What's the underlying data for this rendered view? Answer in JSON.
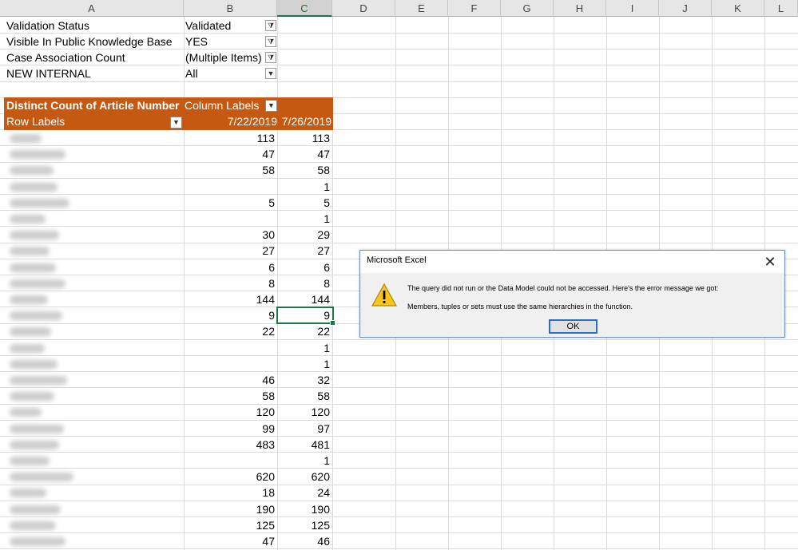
{
  "columns": [
    "A",
    "B",
    "C",
    "D",
    "E",
    "F",
    "G",
    "H",
    "I",
    "J",
    "K",
    "L"
  ],
  "filters": [
    {
      "label": "Validation Status",
      "value": "Validated",
      "icon": "filter-applied-icon"
    },
    {
      "label": "Visible In Public Knowledge Base",
      "value": "YES",
      "icon": "filter-applied-icon"
    },
    {
      "label": "Case Association Count",
      "value": "(Multiple Items)",
      "icon": "filter-applied-icon"
    },
    {
      "label": "NEW INTERNAL",
      "value": "All",
      "icon": "dropdown-arrow-icon"
    }
  ],
  "pivot": {
    "measure_header": "Distinct Count of Article Number",
    "column_labels": "Column Labels",
    "row_labels": "Row Labels",
    "col_dates": [
      "7/22/2019",
      "7/26/2019"
    ],
    "header_color": "#c65911",
    "rows": [
      [
        "113",
        "113"
      ],
      [
        "47",
        "47"
      ],
      [
        "58",
        "58"
      ],
      [
        "",
        "1"
      ],
      [
        "5",
        "5"
      ],
      [
        "",
        "1"
      ],
      [
        "30",
        "29"
      ],
      [
        "27",
        "27"
      ],
      [
        "6",
        "6"
      ],
      [
        "8",
        "8"
      ],
      [
        "144",
        "144"
      ],
      [
        "9",
        "9"
      ],
      [
        "22",
        "22"
      ],
      [
        "",
        "1"
      ],
      [
        "",
        "1"
      ],
      [
        "46",
        "32"
      ],
      [
        "58",
        "58"
      ],
      [
        "120",
        "120"
      ],
      [
        "99",
        "97"
      ],
      [
        "483",
        "481"
      ],
      [
        "",
        "1"
      ],
      [
        "620",
        "620"
      ],
      [
        "18",
        "24"
      ],
      [
        "190",
        "190"
      ],
      [
        "125",
        "125"
      ],
      [
        "47",
        "46"
      ]
    ]
  },
  "dialog": {
    "title": "Microsoft Excel",
    "message": "The query did not run or the Data Model could not be accessed. Here's the error message we got:",
    "detail": "Members, tuples or sets must use the same hierarchies in the  function.",
    "ok_label": "OK",
    "close_glyph": "✕",
    "icon": "warning-icon"
  },
  "accent_color": "#217346"
}
